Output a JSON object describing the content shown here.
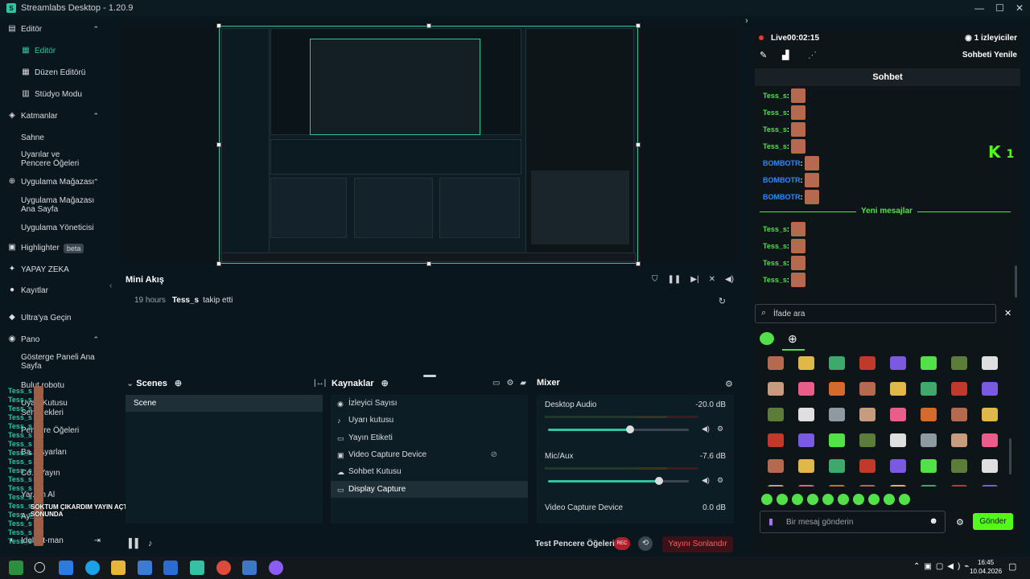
{
  "app": {
    "title": "Streamlabs Desktop - 1.20.9"
  },
  "sidebar": {
    "sections": [
      {
        "label": "Editör",
        "items": [
          "Editör",
          "Düzen Editörü",
          "Stüdyo Modu"
        ]
      },
      {
        "label": "Katmanlar",
        "items": [
          "Sahne",
          "Uyarılar ve Pencere Öğeleri"
        ]
      },
      {
        "label": "Uygulama Mağazası",
        "items": [
          "Uygulama Mağazası Ana Sayfa",
          "Uygulama Yöneticisi"
        ]
      }
    ],
    "highlighter": "Highlighter",
    "beta": "beta",
    "ai": "YAPAY ZEKA",
    "recordings": "Kayıtlar",
    "ultra": "Ultra'ya Geçin",
    "panel": "Pano",
    "panel_items": [
      "Gösterge Paneli Ana Sayfa",
      "Bulut robotu",
      "Uyarı Kutusu",
      "Sen... ekleri",
      "Pencere Öğeleri",
      "Ba... Ayarları",
      "Co... Yayın",
      "Yar... n Al",
      "Ay..."
    ],
    "user": "Idol... t-man"
  },
  "overlay": {
    "names": [
      "Tess_s",
      "Tess_s",
      "Tess_s",
      "Tess_s",
      "Tess_s",
      "Tess_s",
      "Tess_s",
      "Tess_s",
      "Tess_s",
      "Tess_s",
      "Tess_s",
      "Tess_s",
      "Tess_s",
      "Tess_s",
      "Tess_s",
      "Tess_s",
      "Tess_s",
      "Tess_s"
    ],
    "caption_line1": "SOKTUM ÇIKARDIM YAYIN AÇTI",
    "caption_line2": "SONUNDA"
  },
  "minifeed": {
    "title": "Mini Akış",
    "time": "19 hours",
    "user": "Tess_s",
    "action": "takip etti"
  },
  "scenes": {
    "title": "Scenes",
    "items": [
      "Scene"
    ]
  },
  "sources": {
    "title": "Kaynaklar",
    "items": [
      "İzleyici Sayısı",
      "Uyarı kutusu",
      "Yayın Etiketi",
      "Video Capture Device",
      "Sohbet Kutusu",
      "Display Capture"
    ],
    "selected_index": 5
  },
  "mixer": {
    "title": "Mixer",
    "channels": [
      {
        "name": "Desktop Audio",
        "db": "-20.0 dB",
        "level": 0.58
      },
      {
        "name": "Mic/Aux",
        "db": "-7.6 dB",
        "level": 0.79
      },
      {
        "name": "Video Capture Device",
        "db": "0.0 dB",
        "level": 0
      }
    ]
  },
  "footer": {
    "test_label": "Test Pencere Öğeleri",
    "rec_label": "REC",
    "end_stream": "Yayını Sonlandır"
  },
  "chat": {
    "live_label": "Live",
    "live_time": "00:02:15",
    "viewers": "1 izleyiciler",
    "refresh": "Sohbeti Yenile",
    "title": "Sohbet",
    "new_messages": "Yeni mesajlar",
    "kick_count": "1",
    "messages": [
      {
        "user": "Tess_s",
        "color": "#53e14a"
      },
      {
        "user": "Tess_s",
        "color": "#53e14a"
      },
      {
        "user": "Tess_s",
        "color": "#53e14a"
      },
      {
        "user": "Tess_s",
        "color": "#53e14a"
      },
      {
        "user": "BOMBOTR",
        "color": "#2e8bff"
      },
      {
        "user": "BOMBOTR",
        "color": "#2e8bff"
      },
      {
        "user": "BOMBOTR",
        "color": "#2e8bff"
      }
    ],
    "messages_after": [
      {
        "user": "Tess_s",
        "color": "#53e14a"
      },
      {
        "user": "Tess_s",
        "color": "#53e14a"
      },
      {
        "user": "Tess_s",
        "color": "#53e14a"
      },
      {
        "user": "Tess_s",
        "color": "#53e14a"
      }
    ],
    "search_placeholder": "İfade ara",
    "input_placeholder": "Bir mesaj gönderin",
    "send": "Gönder"
  },
  "taskbar": {
    "time": "16:45",
    "date": "10.04.2026"
  },
  "colors": {
    "accent": "#31c3a2",
    "kick_green": "#53fc18",
    "end_red": "#b11d2b"
  }
}
